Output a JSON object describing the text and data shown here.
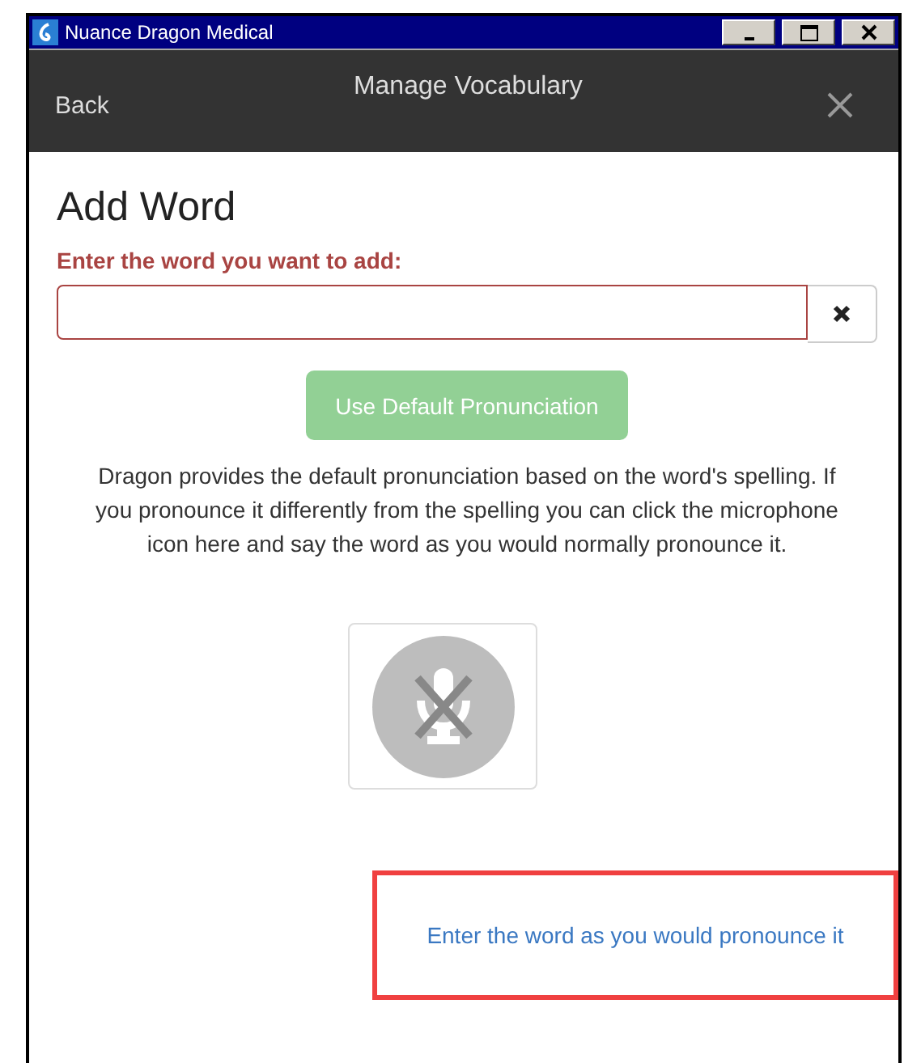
{
  "window": {
    "title": "Nuance Dragon Medical"
  },
  "header": {
    "back": "Back",
    "title": "Manage Vocabulary"
  },
  "page": {
    "heading": "Add Word",
    "field_label": "Enter the word you want to add:",
    "default_button": {
      "label": "Use Default Pronunciation",
      "disabled": true
    },
    "help_text": "Dragon provides the default pronunciation based on the word's spelling. If you pronounce it differently from the spelling you can click the microphone icon here and say the word as you would normally pronounce it.",
    "mic_button": {
      "disabled": true
    },
    "link": "Enter the word as you would pronounce it"
  }
}
